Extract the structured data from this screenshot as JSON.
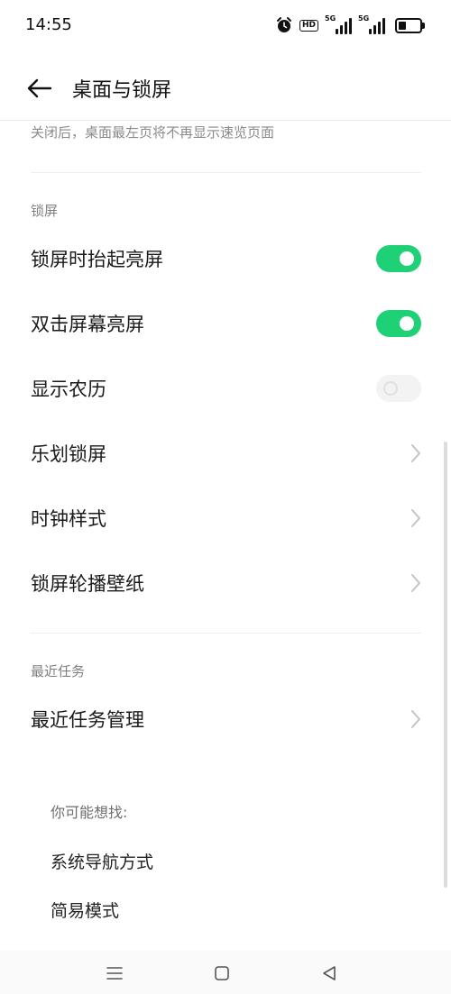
{
  "status_bar": {
    "time": "14:55",
    "hd_label": "HD",
    "sim1_label": "5G",
    "sim2_label": "5G",
    "icons": [
      "alarm-icon",
      "hd-icon",
      "signal-icon",
      "signal-icon",
      "battery-icon"
    ],
    "battery_level": 0.35
  },
  "header": {
    "title": "桌面与锁屏",
    "back_icon": "arrow-left-icon"
  },
  "partial_item": {
    "description": "关闭后，桌面最左页将不再显示速览页面"
  },
  "lock_section": {
    "title": "锁屏",
    "items": [
      {
        "label": "锁屏时抬起亮屏",
        "control": "toggle",
        "state": true
      },
      {
        "label": "双击屏幕亮屏",
        "control": "toggle",
        "state": true
      },
      {
        "label": "显示农历",
        "control": "toggle",
        "state": false
      },
      {
        "label": "乐划锁屏",
        "control": "chevron"
      },
      {
        "label": "时钟样式",
        "control": "chevron"
      },
      {
        "label": "锁屏轮播壁纸",
        "control": "chevron"
      }
    ]
  },
  "recent_section": {
    "title": "最近任务",
    "items": [
      {
        "label": "最近任务管理",
        "control": "chevron"
      }
    ]
  },
  "suggestions": {
    "title": "你可能想找:",
    "items": [
      "系统导航方式",
      "简易模式"
    ]
  },
  "nav_bar": {
    "icons": [
      "menu-icon",
      "home-icon",
      "back-triangle-icon"
    ]
  },
  "colors": {
    "toggle_on": "#1fd176",
    "toggle_off": "#f3f3f3",
    "secondary_text": "#8a8a8a"
  }
}
